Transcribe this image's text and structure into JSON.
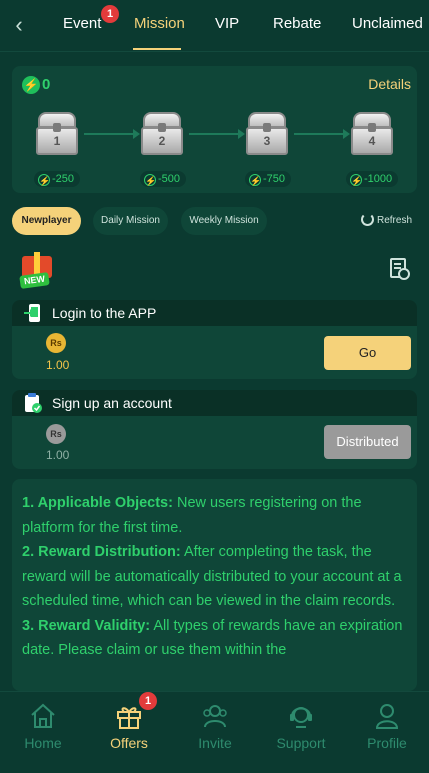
{
  "nav": {
    "tabs": [
      {
        "label": "Event",
        "badge": "1"
      },
      {
        "label": "Mission"
      },
      {
        "label": "VIP"
      },
      {
        "label": "Rebate"
      },
      {
        "label": "Unclaimed"
      }
    ],
    "active_tab": "Mission"
  },
  "chests": {
    "score": "0",
    "details_label": "Details",
    "items": [
      {
        "number": "1",
        "requirement": "-250"
      },
      {
        "number": "2",
        "requirement": "-500"
      },
      {
        "number": "3",
        "requirement": "-750"
      },
      {
        "number": "4",
        "requirement": "-1000"
      }
    ]
  },
  "filters": {
    "items": [
      "Newplayer",
      "Daily Mission",
      "Weekly Mission"
    ],
    "active": "Newplayer",
    "refresh_label": "Refresh"
  },
  "new_badge": "NEW",
  "tasks": [
    {
      "title": "Login to the APP",
      "currency": "Rs",
      "amount": "1.00",
      "button": "Go",
      "state": "available"
    },
    {
      "title": "Sign up an account",
      "currency": "Rs",
      "amount": "1.00",
      "button": "Distributed",
      "state": "distributed"
    }
  ],
  "rules": [
    {
      "heading": "1. Applicable Objects:",
      "text": " New users registering on the platform for the first time."
    },
    {
      "heading": "2. Reward Distribution:",
      "text": " After completing the task, the reward will be automatically distributed to your account at a scheduled time, which can be viewed in the claim records."
    },
    {
      "heading": "3. Reward Validity:",
      "text": " All types of rewards have an expiration date. Please claim or use them within the"
    }
  ],
  "bottom_nav": [
    {
      "label": "Home",
      "icon": "home-icon"
    },
    {
      "label": "Offers",
      "icon": "gift-icon",
      "badge": "1"
    },
    {
      "label": "Invite",
      "icon": "invite-icon"
    },
    {
      "label": "Support",
      "icon": "support-icon"
    },
    {
      "label": "Profile",
      "icon": "profile-icon"
    }
  ],
  "colors": {
    "background": "#0b3a30",
    "panel": "#0f4638",
    "accent": "#f5d27a",
    "green": "#2fd06c",
    "badge": "#e23b3b"
  }
}
